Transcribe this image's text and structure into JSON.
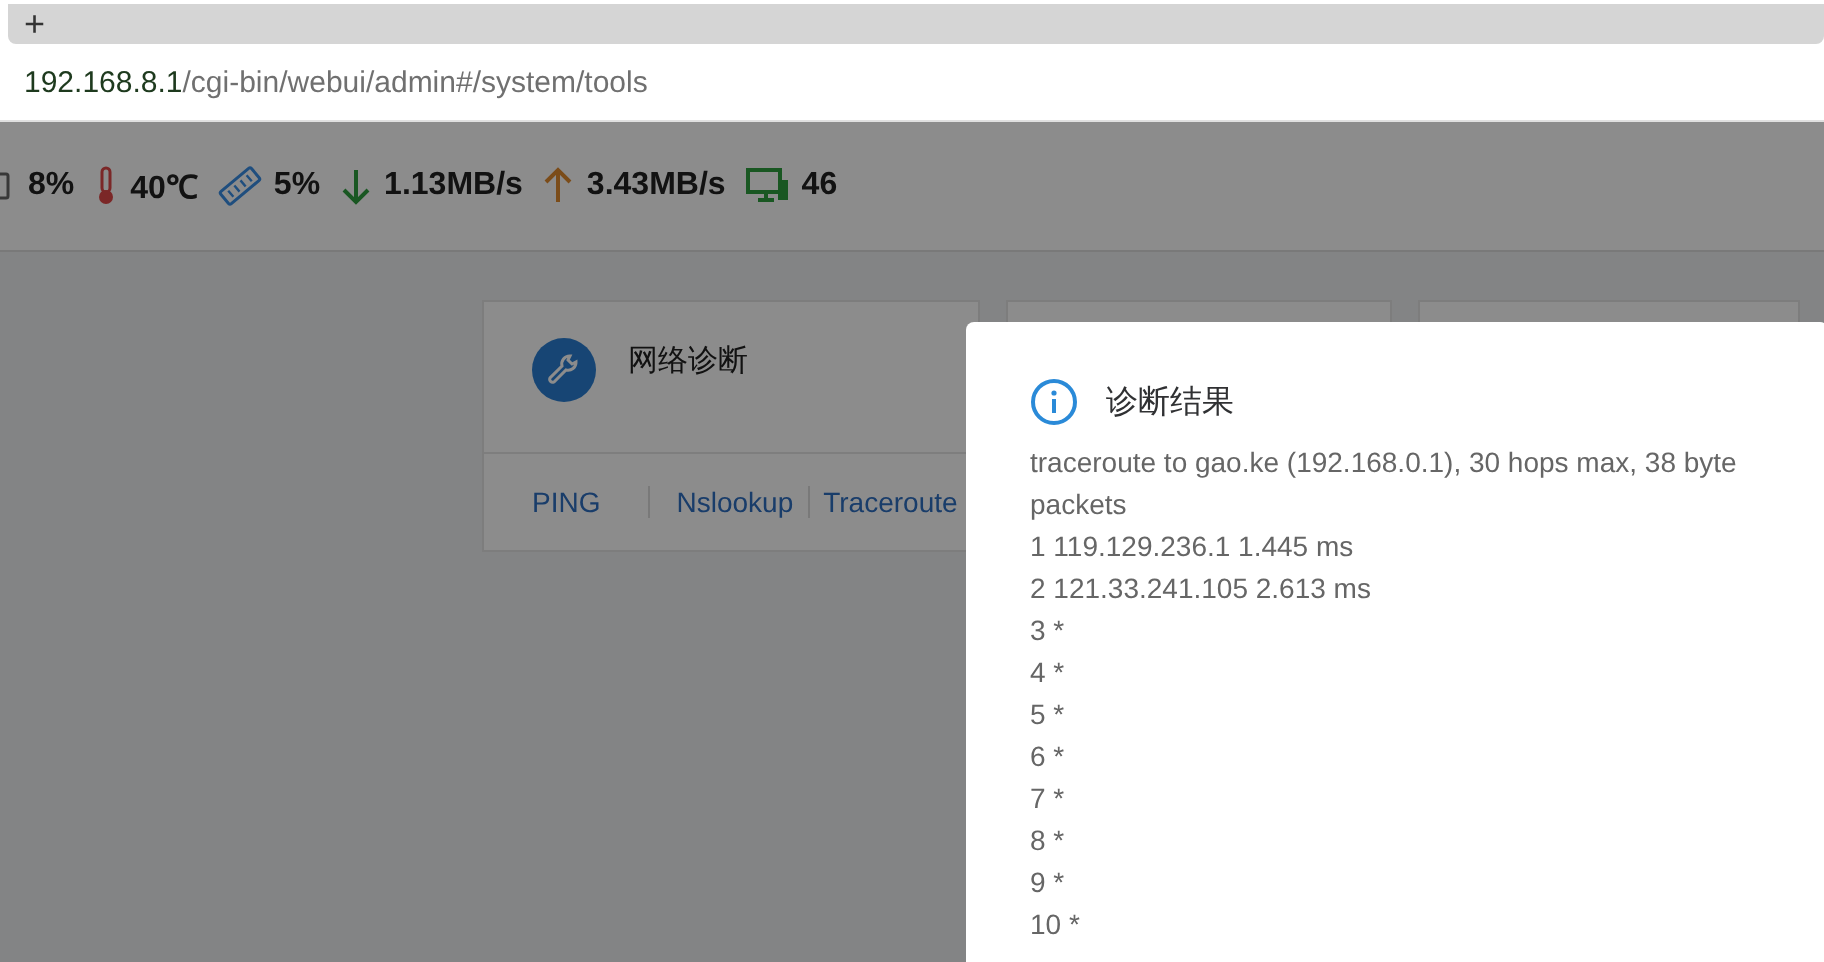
{
  "browser": {
    "new_tab": "+",
    "address": {
      "host": "192.168.8.1",
      "path": "/cgi-bin/webui/admin#/system/tools"
    }
  },
  "status": [
    {
      "kind": "cpu",
      "value": "8%"
    },
    {
      "kind": "temperature",
      "value": "40℃"
    },
    {
      "kind": "memory",
      "value": "5%"
    },
    {
      "kind": "download",
      "value": "1.13MB/s"
    },
    {
      "kind": "upload",
      "value": "3.43MB/s"
    },
    {
      "kind": "devices",
      "value": "46"
    }
  ],
  "cards": [
    {
      "title": "网络诊断",
      "links": [
        "PING",
        "Nslookup",
        "Traceroute"
      ]
    }
  ],
  "dialog": {
    "title": "诊断结果",
    "lines": [
      "traceroute to gao.ke (192.168.0.1), 30 hops max, 38 byte packets",
      "1 119.129.236.1 1.445 ms",
      "2 121.33.241.105 2.613 ms",
      "3 *",
      "4 *",
      "5 *",
      "6 *",
      "7 *",
      "8 *",
      "9 *",
      "10 *"
    ]
  }
}
